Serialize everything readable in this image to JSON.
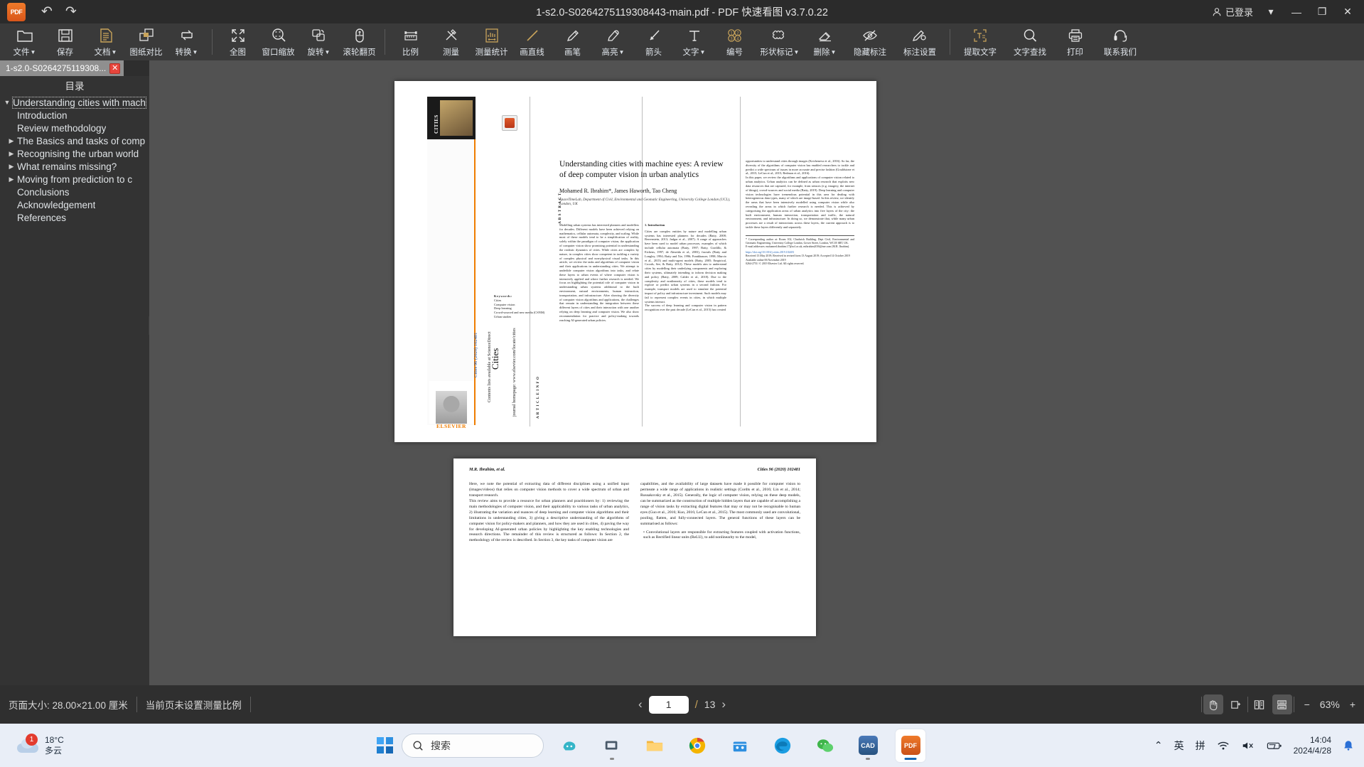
{
  "titlebar": {
    "app_logo": "pdf-app-logo",
    "undo": "↶",
    "redo": "↷",
    "title": "1-s2.0-S0264275119308443-main.pdf - PDF 快速看图 v3.7.0.22",
    "login_label": "已登录",
    "minimize": "—",
    "maximize": "❐",
    "close": "✕",
    "chevron": "▾"
  },
  "toolbar": {
    "items": [
      {
        "label": "文件",
        "icon": "folder-icon",
        "caret": true
      },
      {
        "label": "保存",
        "icon": "save-icon",
        "caret": false
      },
      {
        "label": "文档",
        "icon": "document-icon",
        "caret": true
      },
      {
        "label": "图纸对比",
        "icon": "compare-icon",
        "caret": false
      },
      {
        "label": "转换",
        "icon": "convert-icon",
        "caret": true
      },
      {
        "label": "全图",
        "icon": "fit-page-icon",
        "caret": false
      },
      {
        "label": "窗口缩放",
        "icon": "zoom-window-icon",
        "caret": false
      },
      {
        "label": "旋转",
        "icon": "rotate-icon",
        "caret": true
      },
      {
        "label": "滚轮翻页",
        "icon": "scroll-page-icon",
        "caret": false
      },
      {
        "label": "比例",
        "icon": "scale-ruler-icon",
        "caret": false
      },
      {
        "label": "测量",
        "icon": "measure-icon",
        "caret": false
      },
      {
        "label": "测量统计",
        "icon": "measure-stats-icon",
        "caret": false
      },
      {
        "label": "画直线",
        "icon": "line-icon",
        "caret": false
      },
      {
        "label": "画笔",
        "icon": "pen-icon",
        "caret": false
      },
      {
        "label": "高亮",
        "icon": "highlighter-icon",
        "caret": true
      },
      {
        "label": "箭头",
        "icon": "arrow-icon",
        "caret": false
      },
      {
        "label": "文字",
        "icon": "text-icon",
        "caret": true
      },
      {
        "label": "编号",
        "icon": "numbering-icon",
        "caret": false
      },
      {
        "label": "形状标记",
        "icon": "shape-markup-icon",
        "caret": true
      },
      {
        "label": "删除",
        "icon": "eraser-icon",
        "caret": true
      },
      {
        "label": "隐藏标注",
        "icon": "hide-annotation-icon",
        "caret": false
      },
      {
        "label": "标注设置",
        "icon": "annotation-settings-icon",
        "caret": false
      },
      {
        "label": "提取文字",
        "icon": "extract-text-icon",
        "caret": false
      },
      {
        "label": "文字查找",
        "icon": "search-text-icon",
        "caret": false
      },
      {
        "label": "打印",
        "icon": "print-icon",
        "caret": false
      },
      {
        "label": "联系我们",
        "icon": "headset-icon",
        "caret": false
      }
    ]
  },
  "sidebar": {
    "tab_name": "1-s2.0-S0264275119308...",
    "tab_close": "✕",
    "toc_header": "目录",
    "toc": [
      {
        "label": "Understanding cities with mach",
        "level": 0,
        "expander": "▼",
        "selected": true
      },
      {
        "label": "Introduction",
        "level": 1,
        "expander": "",
        "selected": false
      },
      {
        "label": "Review methodology",
        "level": 1,
        "expander": "",
        "selected": false
      },
      {
        "label": "The Basics and tasks of comp",
        "level": 1,
        "expander": "▶",
        "selected": false
      },
      {
        "label": "Recognising the urban world",
        "level": 1,
        "expander": "▶",
        "selected": false
      },
      {
        "label": "What remains missing?",
        "level": 1,
        "expander": "▶",
        "selected": false
      },
      {
        "label": "Moving from prediction to c",
        "level": 1,
        "expander": "▶",
        "selected": false
      },
      {
        "label": "Conclusions",
        "level": 1,
        "expander": "",
        "selected": false
      },
      {
        "label": "Acknowledgement",
        "level": 1,
        "expander": "",
        "selected": false
      },
      {
        "label": "References",
        "level": 1,
        "expander": "",
        "selected": false
      }
    ],
    "collapse_handle": "‹"
  },
  "document": {
    "page1": {
      "journal_cover_title": "CITIES",
      "sciencedirect_line": "Contents lists available at ScienceDirect",
      "journal_name": "Cities",
      "homepage_line": "journal homepage: www.elsevier.com/locate/cities",
      "issn_line": "Cities 96 (2020) 102481",
      "elsevier_word": "ELSEVIER",
      "title": "Understanding cities with machine eyes: A review of deep computer vision in urban analytics",
      "authors": "Mohamed R. Ibrahim*, James Haworth, Tao Cheng",
      "affiliation": "SpaceTimeLab, Department of Civil, Environmental and Geomatic Engineering, University College London (UCL), London, UK",
      "article_info_heading": "A R T I C L E   I N F O",
      "abstract_heading": "A B S T R A C T",
      "keywords_heading": "Keywords:",
      "keywords": "Cities\nComputer vision\nDeep learning\nCrowd-sourced and new media (CSNM)\nUrban studies",
      "abstract": "Modelling urban systems has interested planners and modellers for decades. Different models have been achieved relying on mathematics, cellular automata, complexity, and scaling. While most of these models tend to be a simplification of reality, solely within the paradigm of computer vision, the application of computer vision show promising potential in understanding the realistic dynamics of cities. While cities are complex by nature, in complex cities show competent in tackling a variety of complex physical and non-physical visual tasks. In this article, we review the tasks and algorithms of computer vision and their applications in understanding cities. We attempt to underlide computer vision algorithms into tasks, and relate these layers to urban events of where computer vision is intensively applied and where further research is needed. We focus on highlighting the potential role of computer vision in understanding urban systems additional to the built environment, natural environments, human interaction, transportation, and infrastructure. After showing the diversity of computer vision algorithms and applications, the challenges that remain in understanding the integration between these different layers of cities and their interaction with one another relying on deep learning and computer vision. We also show recommendation for practice and policy-making towards reaching AI-generated urban policies.",
      "intro_heading": "1. Introduction",
      "intro_text": "Cities are complex entities by nature and modelling urban systems has interested planners for decades (Batty, 2008; Berrenstein, 2013; Jadgar et al., 2007). A range of approaches have been used to model urban processes, examples of which include cellular automata (Batty, 1997; Batty, Gordillo, & Eichens, 1997; de Almeida et al., 2003), fractals (Batty and Longley, 1994; Batty and Xie, 1996; Frankhauser, 1998; Murcio et al., 2015) and multi-agent models (Batty, 2005; Empirical, Croods, See, & Batty, 2012). These models aim to understand cities by modelling their underlying components and exploring their systems, ultimately intending to inform decision making and policy (Batty, 2009; Calder et al., 2018). Due to the complexity and nonlinearity of cities, these models tend to explore or predict urban systems in a second fashion. For example, transport models are used to simulate the potential impact of policy and infrastructure investment. Such models may fail to represent complex events in cities, in which multiple systems interact.\nThe success of deep learning and computer vision in pattern recognition over the past decade (LeCun et al., 2015) has created",
      "right_col_text": "opportunities to understand cities through images (Kricheneva et al., 2016). So far, the diversity of the algorithms of computer vision has enabled researchers to tackle and predict a wide spectrum of issues in more accurate and precise fashion (Gouldstone et al., 2015; LeCun et al., 2015; Redmon et al., 2016).\nIn this paper, we review the algorithms and applications of computer vision related to urban analytics. Urban analytics can be defined as urban research that exploits new data resources that are captured, for example, from sensors (e.g. imagery, the internet of things), crowd-sources and social media (Batty, 2019). Deep learning and computer vision technologies have tremendous potential in this area for dealing with heterogeneous data types, many of which are image-based. In this review, we identify the areas that have been intensively modelled using computer vision while also revealing the areas in which further research is needed. This is achieved by categorising the application areas of urban analytics into five layers of the city: the built environment, human interaction, transportation and traffic, the natural environment, and infrastructure. In doing so, we demonstrate that, while many urban processes are a result of interactions across these layers, the current approach is to tackle these layers differently and separately.",
      "footnote": "* Corresponding author at: Room 102, Chadwick Building, Dept Civil, Environmental and Geomatic Engineering, University College London, Gower Street, London, WC1E 6BT, UK.\nE-mail addresses: mohamed.ibrahim.17@ucl.ac.uk, mibrahim2016@me.com (M.R. Ibrahim).",
      "doi_line": "https://doi.org/10.1016/j.cities.2019.102481",
      "received_line": "Received 13 May 2019; Received in revised form 13 August 2019; Accepted 14 October 2019",
      "available_line": "Available online 06 November 2019",
      "copyright_line": "0264-2751/ © 2019 Elsevier Ltd. All rights reserved."
    },
    "page2": {
      "header_left": "M.R. Ibrahim, et al.",
      "header_right": "Cities 96 (2020) 102481",
      "left_col": "Here, we note the potential of extracting data of different disciplines using a unified input (images/videos) that relies on computer vision methods to cover a wide spectrum of urban and transport research.\nThis review aims to provide a resource for urban planners and practitioners by: 1) reviewing the main methodologies of computer vision, and their applicability to various tasks of urban analytics, 2) illustrating the variation and nuances of deep learning and computer vision algorithms and their limitations in understanding cities, 3) giving a descriptive understanding of the algorithms of computer vision for policy-makers and planners, and how they are used in cities, 4) paving the way for developing AI-generated urban policies by highlighting the key enabling technologies and research directions. The remainder of this review is structured as follows: In Section 2, the methodology of the review is described. In Section 3, the key tasks of computer vision are",
      "right_col": "capabilities, and the availability of large datasets have made it possible for computer vision to permeate a wide range of applications in realistic settings (Cordts et al., 2016; Lin et al., 2014; Russakovsky et al., 2015). Generally, the logic of computer vision, relying on these deep models, can be summarized as the construction of multiple hidden layers that are capable of accomplishing a range of vision tasks by extracting digital features that may or may not be recognisable to human eyes (Guo et al., 2016; Kuo, 2016; LeCun et al., 2015). The most commonly used are convolutional, pooling, flatten, and fully-connected layers. The general functions of these layers can be summarised as follows:",
      "bullet": "• Convolutional layers are responsible for extracting features coupled with activation functions, such as Rectified linear units (ReLU), to add nonlinearity to the model,"
    }
  },
  "statusbar": {
    "page_size": "页面大小: 28.00×21.00 厘米",
    "scale_note": "当前页未设置测量比例",
    "prev_arrow": "‹",
    "current_page": "1",
    "page_sep": "/",
    "total_pages": "13",
    "next_arrow": "›",
    "pan_tool": "hand-tool-icon",
    "snapshot_tool": "snapshot-icon",
    "two_page_view": "two-page-view-icon",
    "continuous_view": "continuous-view-icon",
    "zoom_out": "−",
    "zoom_level": "63%",
    "zoom_in": "+"
  },
  "taskbar": {
    "weather_temp": "18°C",
    "weather_desc": "多云",
    "weather_badge": "1",
    "start_button": "windows-start-icon",
    "search_placeholder": "搜索",
    "apps": [
      {
        "name": "copilot",
        "glyph": ""
      },
      {
        "name": "task-view",
        "glyph": ""
      },
      {
        "name": "file-explorer",
        "glyph": ""
      },
      {
        "name": "chrome",
        "glyph": ""
      },
      {
        "name": "store",
        "glyph": ""
      },
      {
        "name": "edge",
        "glyph": ""
      },
      {
        "name": "wechat",
        "glyph": ""
      },
      {
        "name": "cad",
        "glyph": "CAD"
      },
      {
        "name": "pdf-reader",
        "glyph": "PDF"
      }
    ],
    "tray_chevron": "⌃",
    "tray_ime_lang": "英",
    "tray_ime_mode": "拼",
    "tray_wifi": "wifi-icon",
    "tray_volume": "volume-muted-icon",
    "tray_battery": "battery-icon",
    "clock_time": "14:04",
    "clock_date": "2024/4/28",
    "notification": "bell-icon"
  },
  "colors": {
    "accent_gold": "#c9a45b",
    "toolbar_bg": "#3a3a3a",
    "titlebar_bg": "#2b2b2b",
    "panel_bg": "#333333",
    "viewport_bg": "#525252",
    "taskbar_bg": "#e9eef7"
  }
}
